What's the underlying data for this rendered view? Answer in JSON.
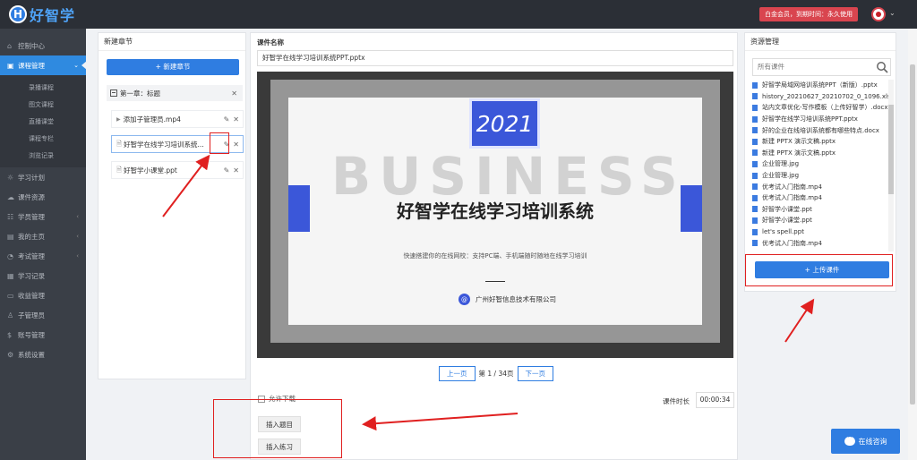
{
  "app": {
    "logo_letter": "H",
    "name": "好智学"
  },
  "header": {
    "vip_text": "白金会员，到期时间：永久使用",
    "caret": "⌄"
  },
  "sidebar": {
    "items": [
      {
        "label": "控制中心",
        "icon": "home-icon",
        "glyph": "⌂"
      },
      {
        "label": "课程管理",
        "icon": "book-icon",
        "glyph": "▣",
        "arrow": "⌄"
      },
      {
        "label": "学习计划",
        "icon": "plan-icon",
        "glyph": "☼"
      },
      {
        "label": "课件资源",
        "icon": "cloud-icon",
        "glyph": "☁"
      },
      {
        "label": "学员管理",
        "icon": "users-icon",
        "glyph": "☷",
        "arrow": "‹"
      },
      {
        "label": "我的主页",
        "icon": "page-icon",
        "glyph": "▤",
        "arrow": "‹"
      },
      {
        "label": "考试管理",
        "icon": "exam-icon",
        "glyph": "◔",
        "arrow": "‹"
      },
      {
        "label": "学习记录",
        "icon": "record-icon",
        "glyph": "▦"
      },
      {
        "label": "收益管理",
        "icon": "wallet-icon",
        "glyph": "▭"
      },
      {
        "label": "子管理员",
        "icon": "admin-icon",
        "glyph": "♙"
      },
      {
        "label": "账号管理",
        "icon": "dollar-icon",
        "glyph": "$"
      },
      {
        "label": "系统设置",
        "icon": "settings-icon",
        "glyph": "⚙"
      }
    ],
    "sub_items": [
      "录播课程",
      "图文课程",
      "直播课堂",
      "课程专栏",
      "浏览记录"
    ]
  },
  "chapters": {
    "title": "新建章节",
    "new_button": "+ 新建章节",
    "chapter_name": "第一章：标题",
    "lessons": [
      {
        "name": "添加子管理员.mp4",
        "type": "video"
      },
      {
        "name": "好智学在线学习培训系统...",
        "type": "doc"
      },
      {
        "name": "好智学小课堂.ppt",
        "type": "doc"
      }
    ],
    "edit_glyph": "✎",
    "delete_glyph": "✕",
    "play_glyph": "▶",
    "doc_glyph": "🗎"
  },
  "courseware": {
    "name_label": "课件名称",
    "name_value": "好智学在线学习培训系统PPT.pptx",
    "slide": {
      "year": "2021",
      "watermark": "BUSINESS",
      "title": "好智学在线学习培训系统",
      "subtitle": "快速搭建你的在线网校：支持PC端、手机端随时随地在线学习培训",
      "company": "广州好智信息技术有限公司",
      "company_mark": "@"
    },
    "prev_label": "上一页",
    "next_label": "下一页",
    "page_info": "第 1 / 34页",
    "allow_download_label": "允许下载",
    "duration_label": "课件时长",
    "duration_value": "00:00:34",
    "insert_question_label": "插入题目",
    "insert_exercise_label": "插入练习"
  },
  "resources": {
    "title": "资源管理",
    "search_placeholder": "所有课件",
    "files": [
      "好智学局域网培训系统PPT（新版）.pptx",
      "history_20210627_20210702_0_1096.xlsx",
      "站内文章优化-写作模板（上传好智学）.docx",
      "好智学在线学习培训系统PPT.pptx",
      "好的企业在线培训系统都有哪些特点.docx",
      "新建 PPTX 演示文稿.pptx",
      "新建 PPTX 演示文稿.pptx",
      "企业管理.jpg",
      "企业管理.jpg",
      "优考试入门指南.mp4",
      "优考试入门指南.mp4",
      "好智学小课堂.ppt",
      "好智学小课堂.ppt",
      "let's spell.ppt",
      "优考试入门指南.mp4"
    ],
    "upload_label": "+ 上传课件"
  },
  "chat": {
    "label": "在线咨询"
  },
  "colors": {
    "primary": "#2f7de1",
    "sidebar": "#3a3f47",
    "annotation": "#e02020",
    "vip": "#d9454f"
  }
}
